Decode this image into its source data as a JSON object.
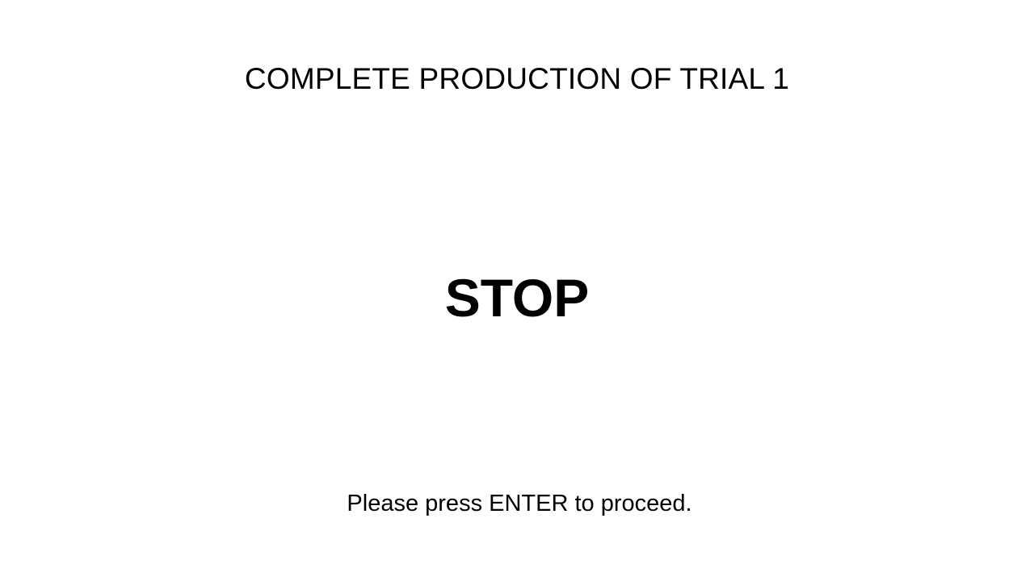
{
  "screen": {
    "heading": "COMPLETE PRODUCTION OF TRIAL 1",
    "stop_label": "STOP",
    "instruction": "Please press ENTER to proceed.",
    "background_color": "#ffffff",
    "text_color": "#000000"
  }
}
